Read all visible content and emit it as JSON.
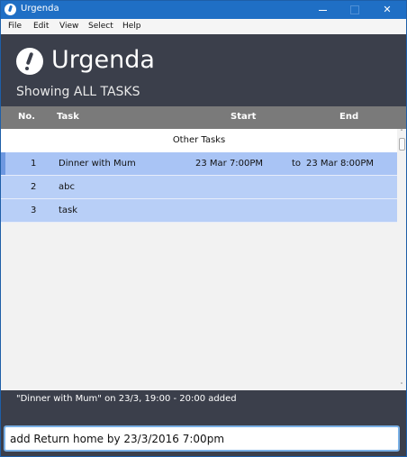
{
  "window": {
    "title": "Urgenda"
  },
  "menu": [
    "File",
    "Edit",
    "View",
    "Select",
    "Help"
  ],
  "header": {
    "app_name": "Urgenda",
    "showing": "Showing ALL TASKS"
  },
  "columns": {
    "no": "No.",
    "task": "Task",
    "start": "Start",
    "end": "End"
  },
  "section_label": "Other Tasks",
  "tasks": [
    {
      "no": "1",
      "task": "Dinner with Mum",
      "start": "23 Mar 7:00PM",
      "to": "to",
      "end": "23 Mar 8:00PM",
      "selected": true
    },
    {
      "no": "2",
      "task": "abc",
      "start": "",
      "to": "",
      "end": ""
    },
    {
      "no": "3",
      "task": "task",
      "start": "",
      "to": "",
      "end": ""
    }
  ],
  "feedback": "\"Dinner with Mum\" on 23/3, 19:00 - 20:00 added",
  "command": {
    "value": "add Return home by 23/3/2016 7:00pm"
  },
  "colors": {
    "titlebar": "#1f6fc5",
    "header": "#3b3f4b",
    "row": "#b8cff7",
    "column_header": "#7a7a7a"
  }
}
